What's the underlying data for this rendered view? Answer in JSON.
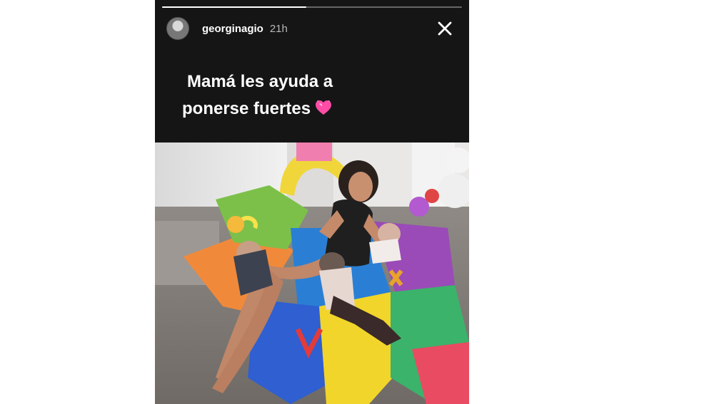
{
  "story": {
    "username": "georginagio",
    "time_ago": "21h",
    "progress": 0.48,
    "caption_line1": "Mamá les ayuda a",
    "caption_line2": "ponerse fuertes",
    "caption_emoji": "heart-icon"
  },
  "icons": {
    "close": "close-icon",
    "avatar": "avatar"
  },
  "colors": {
    "story_background": "#151515",
    "text": "#ffffff",
    "time_text": "#b8b8b8",
    "heart": "#ff4da6"
  }
}
